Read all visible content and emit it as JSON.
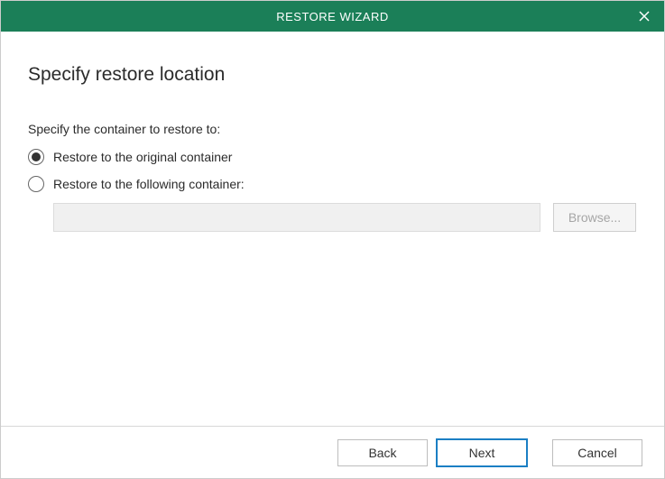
{
  "titlebar": {
    "title": "RESTORE WIZARD"
  },
  "page": {
    "heading": "Specify restore location",
    "instruction": "Specify the container to restore to:"
  },
  "options": {
    "original": {
      "label": "Restore to the original container",
      "selected": true
    },
    "custom": {
      "label": "Restore to the following container:",
      "selected": false,
      "path": "",
      "browse_label": "Browse..."
    }
  },
  "footer": {
    "back": "Back",
    "next": "Next",
    "cancel": "Cancel"
  }
}
